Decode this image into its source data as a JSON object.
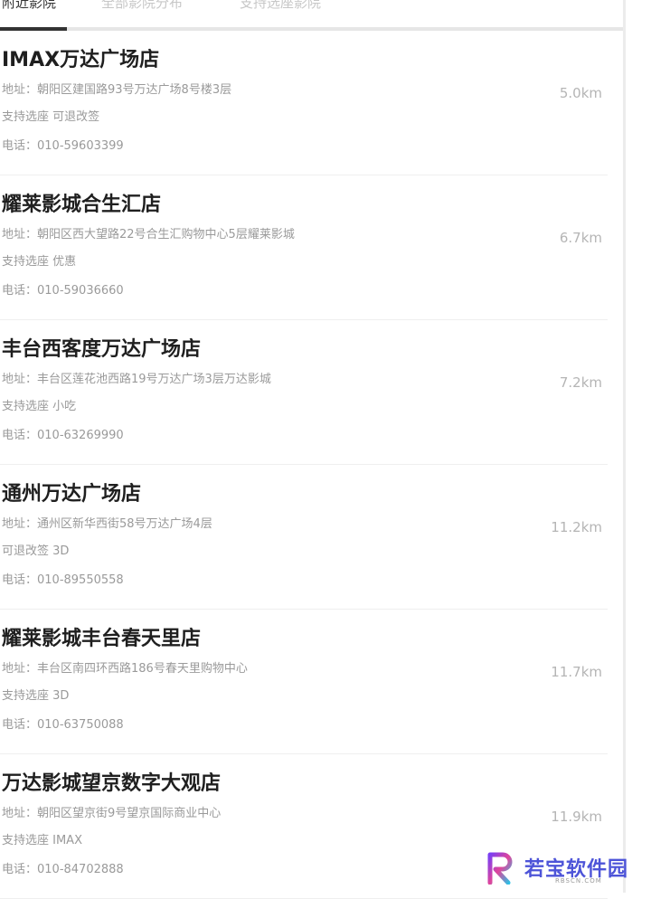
{
  "tabs": [
    {
      "label": "附近影院",
      "active": true
    },
    {
      "label": "全部影院分布",
      "active": false
    },
    {
      "label": "支持选座影院",
      "active": false
    }
  ],
  "cinemas": [
    {
      "name": "IMAX万达广场店",
      "address": "地址：朝阳区建国路93号万达广场8号楼3层",
      "tags": "支持选座  可退改签",
      "phone": "电话：010-59603399",
      "distance": "5.0km"
    },
    {
      "name": "耀莱影城合生汇店",
      "address": "地址：朝阳区西大望路22号合生汇购物中心5层耀莱影城",
      "tags": "支持选座  优惠",
      "phone": "电话：010-59036660",
      "distance": "6.7km"
    },
    {
      "name": "丰台西客度万达广场店",
      "address": "地址：丰台区莲花池西路19号万达广场3层万达影城",
      "tags": "支持选座  小吃",
      "phone": "电话：010-63269990",
      "distance": "7.2km"
    },
    {
      "name": "通州万达广场店",
      "address": "地址：通州区新华西街58号万达广场4层",
      "tags": "可退改签  3D",
      "phone": "电话：010-89550558",
      "distance": "11.2km"
    },
    {
      "name": "耀莱影城丰台春天里店",
      "address": "地址：丰台区南四环西路186号春天里购物中心",
      "tags": "支持选座  3D",
      "phone": "电话：010-63750088",
      "distance": "11.7km"
    },
    {
      "name": "万达影城望京数字大观店",
      "address": "地址：朝阳区望京街9号望京国际商业中心",
      "tags": "支持选座  IMAX",
      "phone": "电话：010-84702888",
      "distance": "11.9km"
    }
  ],
  "watermark": {
    "name": "若宝软件园",
    "site": "RBSCN.COM"
  }
}
